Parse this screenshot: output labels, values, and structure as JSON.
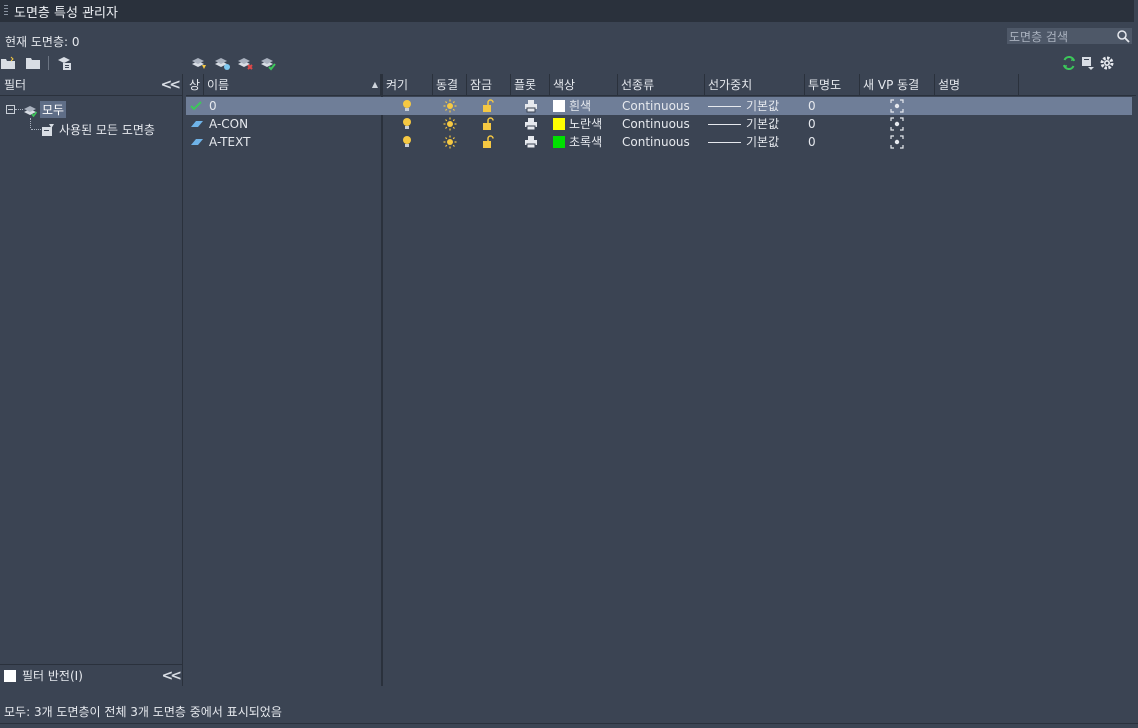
{
  "window": {
    "title": "도면층 특성 관리자"
  },
  "current_layer": "현재 도면층: 0",
  "search": {
    "placeholder": "도면층 검색"
  },
  "filter_pane": {
    "header": "필터",
    "tree": {
      "root": "모두",
      "child": "사용된 모든 도면층"
    },
    "invert_label": "필터 반전(I)"
  },
  "columns": [
    "상",
    "이름",
    "켜기",
    "동결",
    "잠금",
    "플롯",
    "색상",
    "선종류",
    "선가중치",
    "투명도",
    "새 VP 동결",
    "설명"
  ],
  "layers": [
    {
      "name": "0",
      "color_name": "흰색",
      "color_hex": "#ffffff",
      "linetype": "Continuous",
      "lineweight": "기본값",
      "transparency": "0",
      "current": true
    },
    {
      "name": "A-CON",
      "color_name": "노란색",
      "color_hex": "#ffff00",
      "linetype": "Continuous",
      "lineweight": "기본값",
      "transparency": "0",
      "current": false
    },
    {
      "name": "A-TEXT",
      "color_name": "초록색",
      "color_hex": "#00e000",
      "linetype": "Continuous",
      "lineweight": "기본값",
      "transparency": "0",
      "current": false
    }
  ],
  "status_text": "모두: 3개 도면층이 전체 3개 도면층 중에서 표시되었음",
  "colors": {
    "bg": "#3b4453",
    "selected_row": "#6f7e98",
    "icon_yellow": "#f5c842",
    "refresh_green": "#3cc85a"
  }
}
